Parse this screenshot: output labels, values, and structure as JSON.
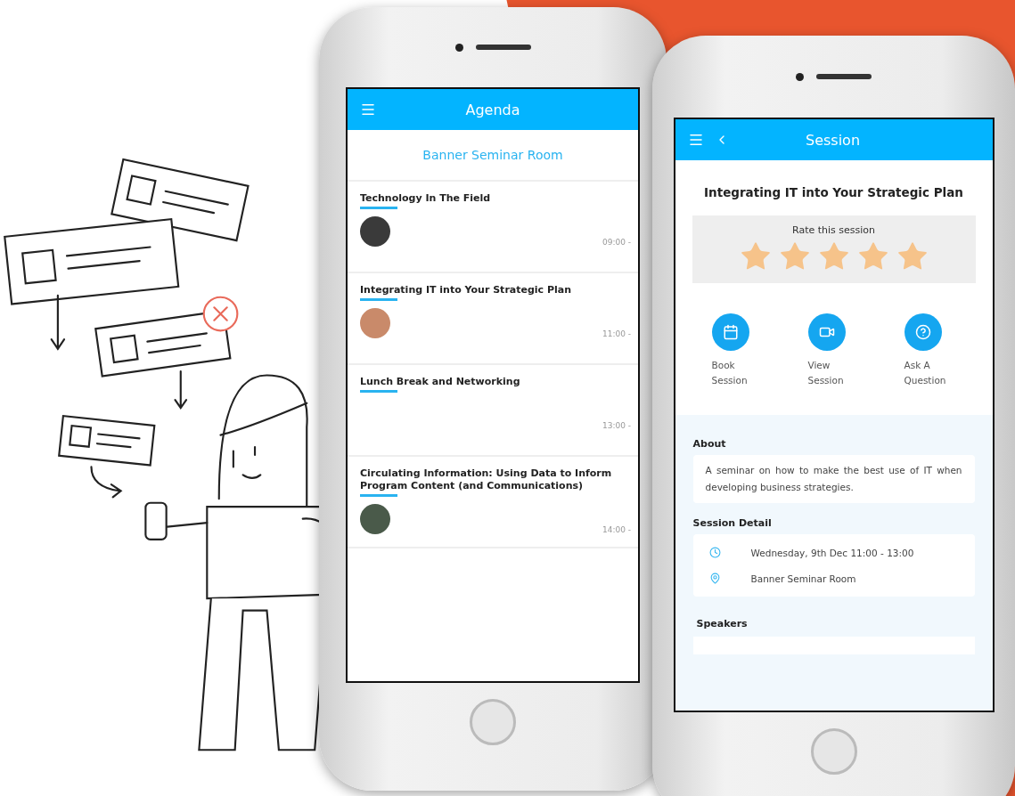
{
  "agenda": {
    "title": "Agenda",
    "room": "Banner Seminar Room",
    "sessions": [
      {
        "title": "Technology In The Field",
        "time": "09:00 -",
        "color": "#3a3a3a"
      },
      {
        "title": "Integrating IT into Your Strategic Plan",
        "time": "11:00 -",
        "color": "#c98a6a"
      },
      {
        "title": "Lunch Break and Networking",
        "time": "13:00 -"
      },
      {
        "title": "Circulating Information: Using Data to Inform Program Content (and Communications)",
        "time": "14:00 -",
        "color": "#4a5a4a"
      }
    ]
  },
  "session": {
    "title": "Session",
    "heading": "Integrating IT into Your Strategic Plan",
    "rating": {
      "label": "Rate this session",
      "stars": 5
    },
    "actions": [
      {
        "kind": "calendar",
        "label": "Book Session"
      },
      {
        "kind": "video",
        "label": "View Session"
      },
      {
        "kind": "question",
        "label": "Ask A Question"
      }
    ],
    "about": {
      "heading": "About",
      "text": "A seminar on how to make the best use of IT when developing business strategies."
    },
    "detail": {
      "heading": "Session Detail",
      "rows": [
        {
          "kind": "clock",
          "text": "Wednesday, 9th Dec 11:00 - 13:00"
        },
        {
          "kind": "location",
          "text": "Banner Seminar Room"
        }
      ]
    },
    "speakers": {
      "heading": "Speakers"
    }
  }
}
